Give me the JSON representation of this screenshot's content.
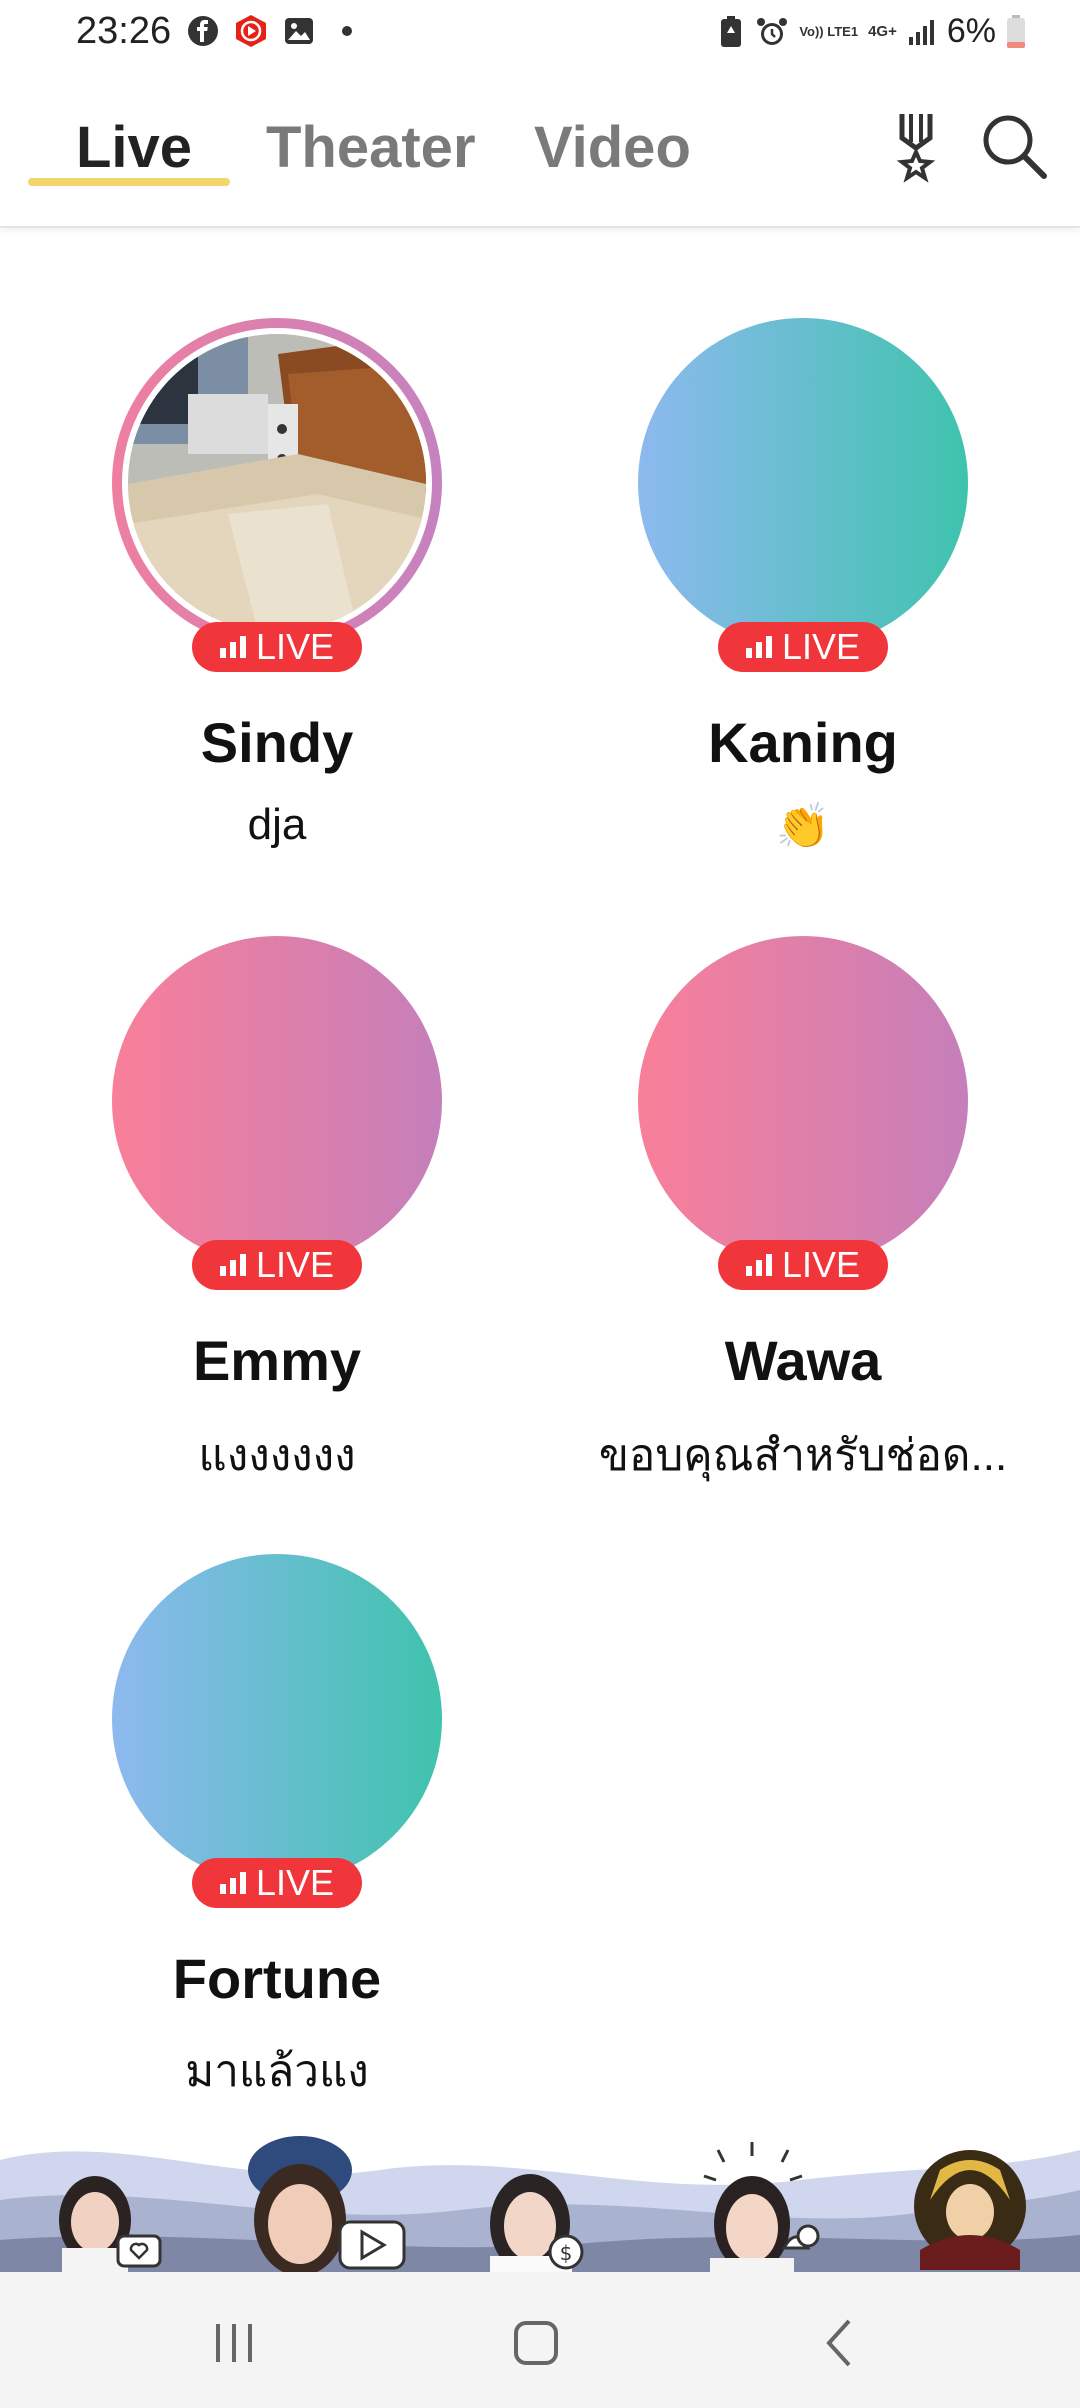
{
  "status_bar": {
    "time": "23:26",
    "battery": "6%",
    "network": "4G+",
    "volte": "Vo)) LTE1"
  },
  "header": {
    "tabs": [
      {
        "label": "Live",
        "active": true
      },
      {
        "label": "Theater",
        "active": false
      },
      {
        "label": "Video",
        "active": false
      }
    ]
  },
  "streams": [
    {
      "name": "Sindy",
      "status": "dja",
      "live_label": "LIVE",
      "avatar": "photo"
    },
    {
      "name": "Kaning",
      "status": "👏",
      "live_label": "LIVE",
      "avatar": "teal-gradient"
    },
    {
      "name": "Emmy",
      "status": "แงงงงงง",
      "live_label": "LIVE",
      "avatar": "pink-gradient"
    },
    {
      "name": "Wawa",
      "status": "ขอบคุณสำหรับช่อด...",
      "live_label": "LIVE",
      "avatar": "pink-gradient"
    },
    {
      "name": "Fortune",
      "status": "มาแล้วแง",
      "live_label": "LIVE",
      "avatar": "teal-gradient"
    }
  ],
  "colors": {
    "live_badge": "#f0363a",
    "tab_underline": "#f2d66d",
    "pink_start": "#f97f99",
    "pink_end": "#c57fba",
    "teal_start": "#8db9ef",
    "teal_end": "#3fc3ad"
  },
  "icons": {
    "header": [
      "medal-icon",
      "search-icon"
    ],
    "nav": [
      "recent-apps-icon",
      "home-icon",
      "back-icon"
    ]
  }
}
